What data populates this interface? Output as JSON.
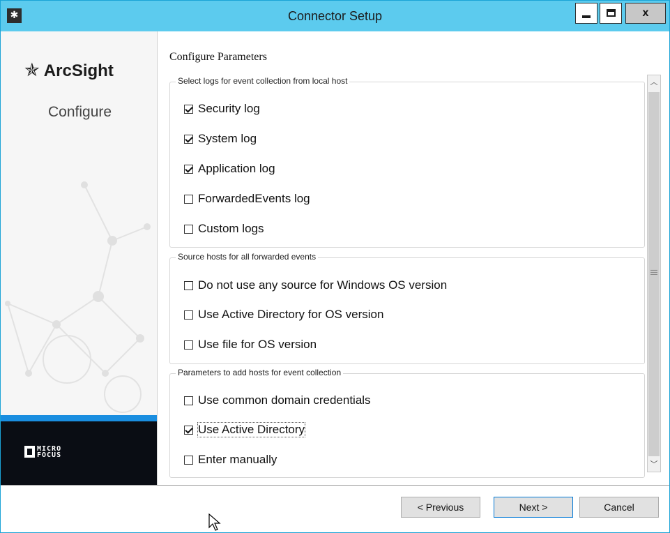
{
  "window": {
    "title": "Connector Setup",
    "app_icon": "arcsight-icon",
    "controls": {
      "close": "x"
    }
  },
  "left_panel": {
    "brand": "ArcSight",
    "step": "Configure",
    "vendor": "MICRO FOCUS",
    "vendor_line1": "MICRO",
    "vendor_line2": "FOCUS",
    "accent_color": "#1a8ee0"
  },
  "content": {
    "section_title": "Configure Parameters",
    "groups": [
      {
        "legend": "Select logs for event collection from local host",
        "items": [
          {
            "label": "Security log",
            "checked": true
          },
          {
            "label": "System log",
            "checked": true
          },
          {
            "label": "Application log",
            "checked": true
          },
          {
            "label": "ForwardedEvents log",
            "checked": false
          },
          {
            "label": "Custom logs",
            "checked": false
          }
        ]
      },
      {
        "legend": "Source hosts for all forwarded events",
        "items": [
          {
            "label": "Do not use any source for Windows OS version",
            "checked": false
          },
          {
            "label": "Use Active Directory for OS version",
            "checked": false
          },
          {
            "label": "Use file for OS version",
            "checked": false
          }
        ]
      },
      {
        "legend": "Parameters to add hosts for event collection",
        "items": [
          {
            "label": "Use common domain credentials",
            "checked": false
          },
          {
            "label": "Use Active Directory",
            "checked": true
          },
          {
            "label": "Enter manually",
            "checked": false
          }
        ]
      }
    ]
  },
  "footer": {
    "previous": "< Previous",
    "next": "Next >",
    "cancel": "Cancel"
  }
}
